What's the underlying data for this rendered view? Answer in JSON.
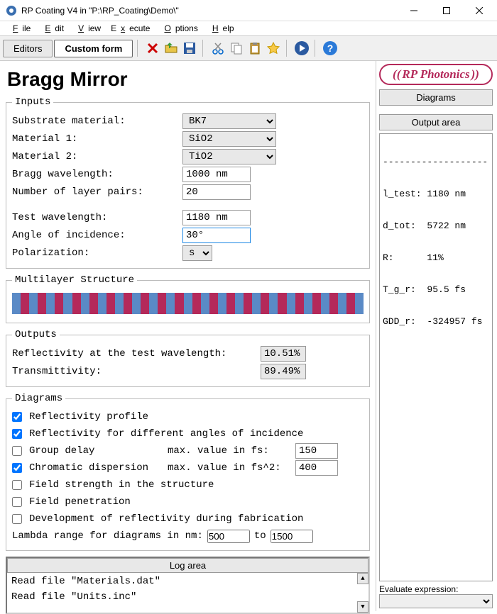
{
  "window": {
    "title": "RP Coating V4 in \"P:\\RP_Coating\\Demo\\\""
  },
  "menu": {
    "file": "File",
    "edit": "Edit",
    "view": "View",
    "execute": "Execute",
    "options": "Options",
    "help": "Help"
  },
  "toolbar": {
    "editors": "Editors",
    "custom": "Custom form"
  },
  "page_title": "Bragg Mirror",
  "inputs": {
    "legend": "Inputs",
    "substrate_lbl": "Substrate material:",
    "substrate_val": "BK7",
    "mat1_lbl": "Material 1:",
    "mat1_val": "SiO2",
    "mat2_lbl": "Material 2:",
    "mat2_val": "TiO2",
    "bragg_lbl": "Bragg wavelength:",
    "bragg_val": "1000 nm",
    "pairs_lbl": "Number of layer pairs:",
    "pairs_val": "20",
    "test_lbl": "Test wavelength:",
    "test_val": "1180 nm",
    "angle_lbl": "Angle of incidence:",
    "angle_val": "30°",
    "pol_lbl": "Polarization:",
    "pol_val": "s"
  },
  "multilayer_legend": "Multilayer Structure",
  "outputs": {
    "legend": "Outputs",
    "refl_lbl": "Reflectivity at the test wavelength:",
    "refl_val": "10.51%",
    "trans_lbl": "Transmittivity:",
    "trans_val": "89.49%"
  },
  "diagrams": {
    "legend": "Diagrams",
    "d1": "Reflectivity profile",
    "d2": "Reflectivity for different angles of incidence",
    "d3": "Group delay",
    "d3_max_lbl": "max. value in fs:",
    "d3_max": "150",
    "d4": "Chromatic dispersion",
    "d4_max_lbl": "max. value in fs^2:",
    "d4_max": "400",
    "d5": "Field strength in the structure",
    "d6": "Field penetration",
    "d7": "Development of reflectivity during fabrication",
    "lambda_lbl": "Lambda range for diagrams in nm:",
    "lambda_from": "500",
    "lambda_to_lbl": "to",
    "lambda_to": "1500"
  },
  "log": {
    "head": "Log area",
    "l1": "Read file \"Materials.dat\"",
    "l2": "Read file \"Units.inc\""
  },
  "side": {
    "logo": "RP Photonics",
    "diag_btn": "Diagrams",
    "out_btn": "Output area",
    "dashes": "-------------------",
    "o1": "l_test: 1180 nm",
    "o2": "d_tot:  5722 nm",
    "o3": "R:      11%",
    "o4": "T_g_r:  95.5 fs",
    "o5": "GDD_r:  -324957 fs",
    "eval_lbl": "Evaluate expression:"
  },
  "chart_data": {
    "type": "table",
    "title": "Output area",
    "rows": [
      {
        "name": "l_test",
        "value": 1180,
        "unit": "nm"
      },
      {
        "name": "d_tot",
        "value": 5722,
        "unit": "nm"
      },
      {
        "name": "R",
        "value": 11,
        "unit": "%"
      },
      {
        "name": "T_g_r",
        "value": 95.5,
        "unit": "fs"
      },
      {
        "name": "GDD_r",
        "value": -324957,
        "unit": "fs"
      }
    ]
  }
}
